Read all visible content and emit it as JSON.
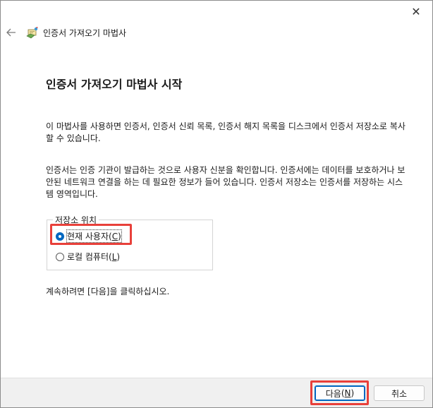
{
  "window": {
    "close_glyph": "✕"
  },
  "header": {
    "title": "인증서 가져오기 마법사"
  },
  "page": {
    "heading": "인증서 가져오기 마법사 시작",
    "para1": "이 마법사를 사용하면 인증서, 인증서 신뢰 목록, 인증서 해지 목록을 디스크에서 인증서 저장소로 복사할 수 있습니다.",
    "para2": "인증서는 인증 기관이 발급하는 것으로 사용자 신분을 확인합니다. 인증서에는 데이터를 보호하거나 보안된 네트워크 연결을 하는 데 필요한 정보가 들어 있습니다. 인증서 저장소는 인증서를 저장하는 시스템 영역입니다.",
    "store_location": {
      "legend": "저장소 위치",
      "options": [
        {
          "label": "현재 사용자",
          "accesskey": "C",
          "selected": true
        },
        {
          "label": "로컬 컴퓨터",
          "accesskey": "L",
          "selected": false
        }
      ]
    },
    "continue_text": "계속하려면 [다음]을 클릭하십시오."
  },
  "footer": {
    "next_label": "다음",
    "next_accesskey": "N",
    "cancel_label": "취소"
  },
  "colors": {
    "accent": "#0067c0",
    "highlight": "#e8403a"
  }
}
